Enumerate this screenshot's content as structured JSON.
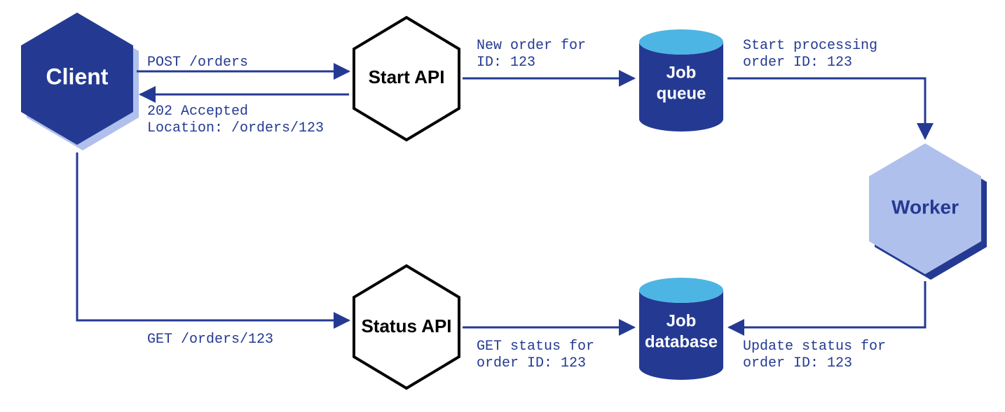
{
  "nodes": {
    "client": {
      "label": "Client"
    },
    "start_api": {
      "label": "Start API"
    },
    "status_api": {
      "label": "Status API"
    },
    "job_queue": {
      "label1": "Job",
      "label2": "queue"
    },
    "job_database": {
      "label1": "Job",
      "label2": "database"
    },
    "worker": {
      "label": "Worker"
    }
  },
  "edges": {
    "client_to_start": {
      "line1": "POST /orders"
    },
    "start_to_client": {
      "line1": "202 Accepted",
      "line2": "Location: /orders/123"
    },
    "start_to_queue": {
      "line1": "New order for",
      "line2": "ID: 123"
    },
    "queue_to_worker": {
      "line1": "Start processing",
      "line2": "order ID: 123"
    },
    "client_to_status": {
      "line1": "GET /orders/123"
    },
    "status_to_db": {
      "line1": "GET status for",
      "line2": "order ID: 123"
    },
    "worker_to_db": {
      "line1": "Update status for",
      "line2": "order ID: 123"
    }
  }
}
